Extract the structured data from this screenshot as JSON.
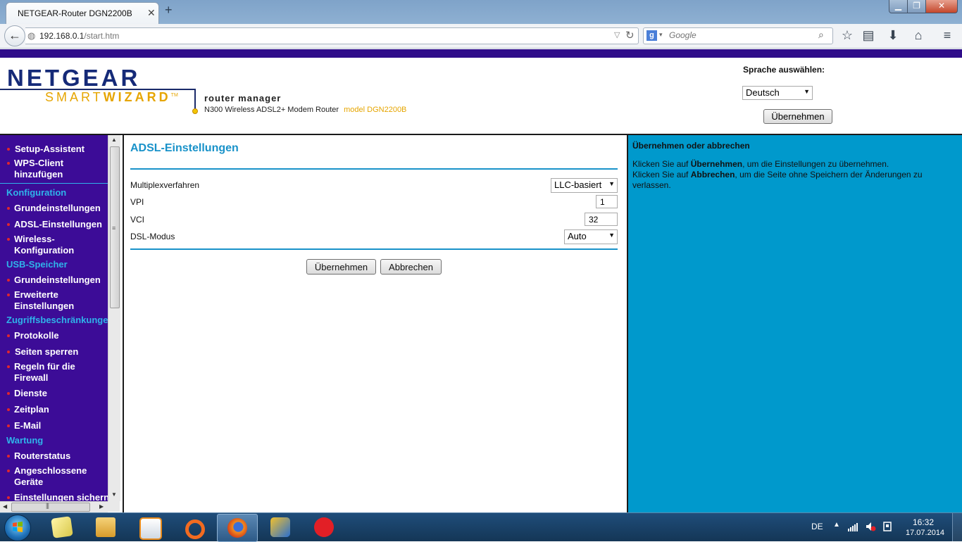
{
  "browser": {
    "tab_title": "NETGEAR-Router DGN2200B",
    "url_host": "192.168.0.1",
    "url_path": "/start.htm",
    "search_placeholder": "Google",
    "search_engine": "google-icon"
  },
  "header": {
    "logo_brand": "NETGEAR",
    "logo_smart": "SMART",
    "logo_wizard": "WIZARD",
    "logo_tm": "TM",
    "title": "router manager",
    "subtitle": "N300 Wireless ADSL2+ Modem Router",
    "model": "model DGN2200B",
    "language_label": "Sprache auswählen:",
    "language_value": "Deutsch",
    "language_apply": "Übernehmen"
  },
  "nav": {
    "setup_wizard": "Setup-Assistent",
    "wps_client": "WPS-Client hinzufügen",
    "section_config": "Konfiguration",
    "basic_settings": "Grundeinstellungen",
    "adsl_settings": "ADSL-Einstellungen",
    "wireless_config": "Wireless-Konfiguration",
    "section_usb": "USB-Speicher",
    "usb_basic": "Grundeinstellungen",
    "usb_advanced": "Erweiterte Einstellungen",
    "section_access": "Zugriffsbeschränkungen",
    "logs": "Protokolle",
    "block_sites": "Seiten sperren",
    "firewall_rules": "Regeln für die Firewall",
    "services": "Dienste",
    "schedule": "Zeitplan",
    "email": "E-Mail",
    "section_maintenance": "Wartung",
    "router_status": "Routerstatus",
    "attached_devices": "Angeschlossene Geräte",
    "backup_settings": "Einstellungen sichern"
  },
  "main": {
    "title": "ADSL-Einstellungen",
    "multiplex_label": "Multiplexverfahren",
    "multiplex_value": "LLC-basiert",
    "vpi_label": "VPI",
    "vpi_value": "1",
    "vci_label": "VCI",
    "vci_value": "32",
    "dsl_mode_label": "DSL-Modus",
    "dsl_mode_value": "Auto",
    "apply_button": "Übernehmen",
    "cancel_button": "Abbrechen"
  },
  "help": {
    "title": "Übernehmen oder abbrechen",
    "line1_prefix": "Klicken Sie auf ",
    "line1_bold": "Übernehmen",
    "line1_suffix": ", um die Einstellungen zu übernehmen.",
    "line2_prefix": "Klicken Sie auf ",
    "line2_bold": "Abbrechen",
    "line2_suffix": ", um die Seite ohne Speichern der Änderungen zu verlassen."
  },
  "taskbar": {
    "language": "DE",
    "time": "16:32",
    "date": "17.07.2014"
  },
  "colors": {
    "nav_background": "#3c0c97",
    "nav_section": "#2fb3ea",
    "accent_blue": "#1992c9",
    "help_background": "#0099cc",
    "logo_gold": "#e6a500"
  }
}
